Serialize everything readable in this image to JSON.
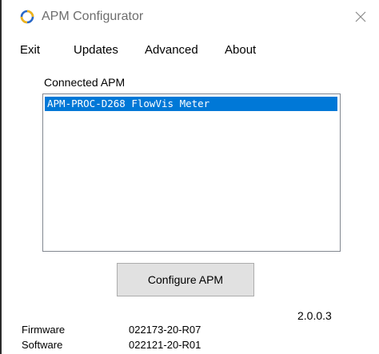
{
  "window": {
    "title": "APM Configurator",
    "app_icon": "apm-logo-icon",
    "close_icon": "close-icon"
  },
  "menu": {
    "items": [
      {
        "label": "Exit"
      },
      {
        "label": "Updates"
      },
      {
        "label": "Advanced"
      },
      {
        "label": "About"
      }
    ]
  },
  "connected": {
    "label": "Connected APM",
    "items": [
      {
        "text": "APM-PROC-D268 FlowVis Meter",
        "selected": true
      }
    ]
  },
  "actions": {
    "configure_label": "Configure APM"
  },
  "info": {
    "version": "2.0.0.3",
    "firmware_label": "Firmware",
    "firmware_value": "022173-20-R07",
    "software_label": "Software",
    "software_value": "022121-20-R01"
  },
  "colors": {
    "selection": "#0078d7",
    "button_face": "#e1e1e1",
    "button_border": "#adadad",
    "title_text": "#6d6d6d",
    "logo_blue": "#2a68c7",
    "logo_gold": "#f2b417"
  }
}
